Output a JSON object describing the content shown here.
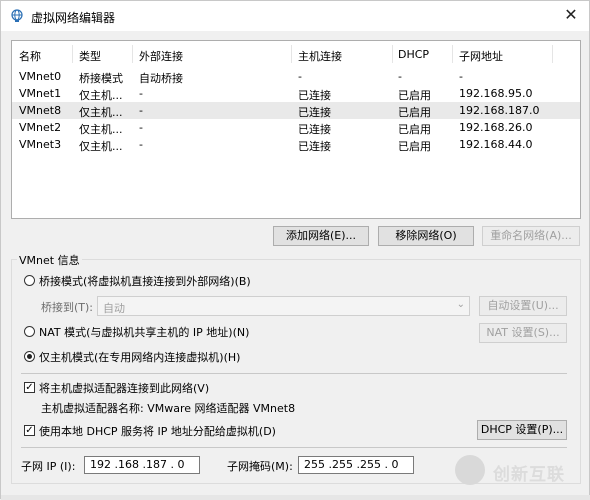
{
  "window": {
    "title": "虚拟网络编辑器",
    "close": "✕"
  },
  "table": {
    "headers": [
      "名称",
      "类型",
      "外部连接",
      "主机连接",
      "DHCP",
      "子网地址"
    ],
    "rows": [
      [
        "VMnet0",
        "桥接模式",
        "自动桥接",
        "-",
        "-",
        "-"
      ],
      [
        "VMnet1",
        "仅主机...",
        "-",
        "已连接",
        "已启用",
        "192.168.95.0"
      ],
      [
        "VMnet8",
        "仅主机...",
        "-",
        "已连接",
        "已启用",
        "192.168.187.0"
      ],
      [
        "VMnet2",
        "仅主机...",
        "-",
        "已连接",
        "已启用",
        "192.168.26.0"
      ],
      [
        "VMnet3",
        "仅主机...",
        "-",
        "已连接",
        "已启用",
        "192.168.44.0"
      ]
    ],
    "selected_row": 2
  },
  "buttons": {
    "add_network": "添加网络(E)...",
    "remove_network": "移除网络(O)",
    "rename_network": "重命名网络(A)..."
  },
  "vmnet_info": {
    "label": "VMnet 信息",
    "bridged_mode": "桥接模式(将虚拟机直接连接到外部网络)(B)",
    "bridge_to_label": "桥接到(T):",
    "bridge_to_value": "自动",
    "auto_settings": "自动设置(U)...",
    "nat_mode": "NAT 模式(与虚拟机共享主机的 IP 地址)(N)",
    "nat_settings": "NAT 设置(S)...",
    "host_only_mode": "仅主机模式(在专用网络内连接虚拟机)(H)",
    "connect_adapter": "将主机虚拟适配器连接到此网络(V)",
    "adapter_name": "主机虚拟适配器名称: VMware 网络适配器 VMnet8",
    "use_dhcp": "使用本地 DHCP 服务将 IP 地址分配给虚拟机(D)",
    "dhcp_settings": "DHCP 设置(P)...",
    "subnet_ip_label": "子网 IP (I):",
    "subnet_ip_value": "192 .168 .187 . 0",
    "subnet_mask_label": "子网掩码(M):",
    "subnet_mask_value": "255 .255 .255 . 0"
  },
  "watermark": {
    "text": "创新互联"
  }
}
